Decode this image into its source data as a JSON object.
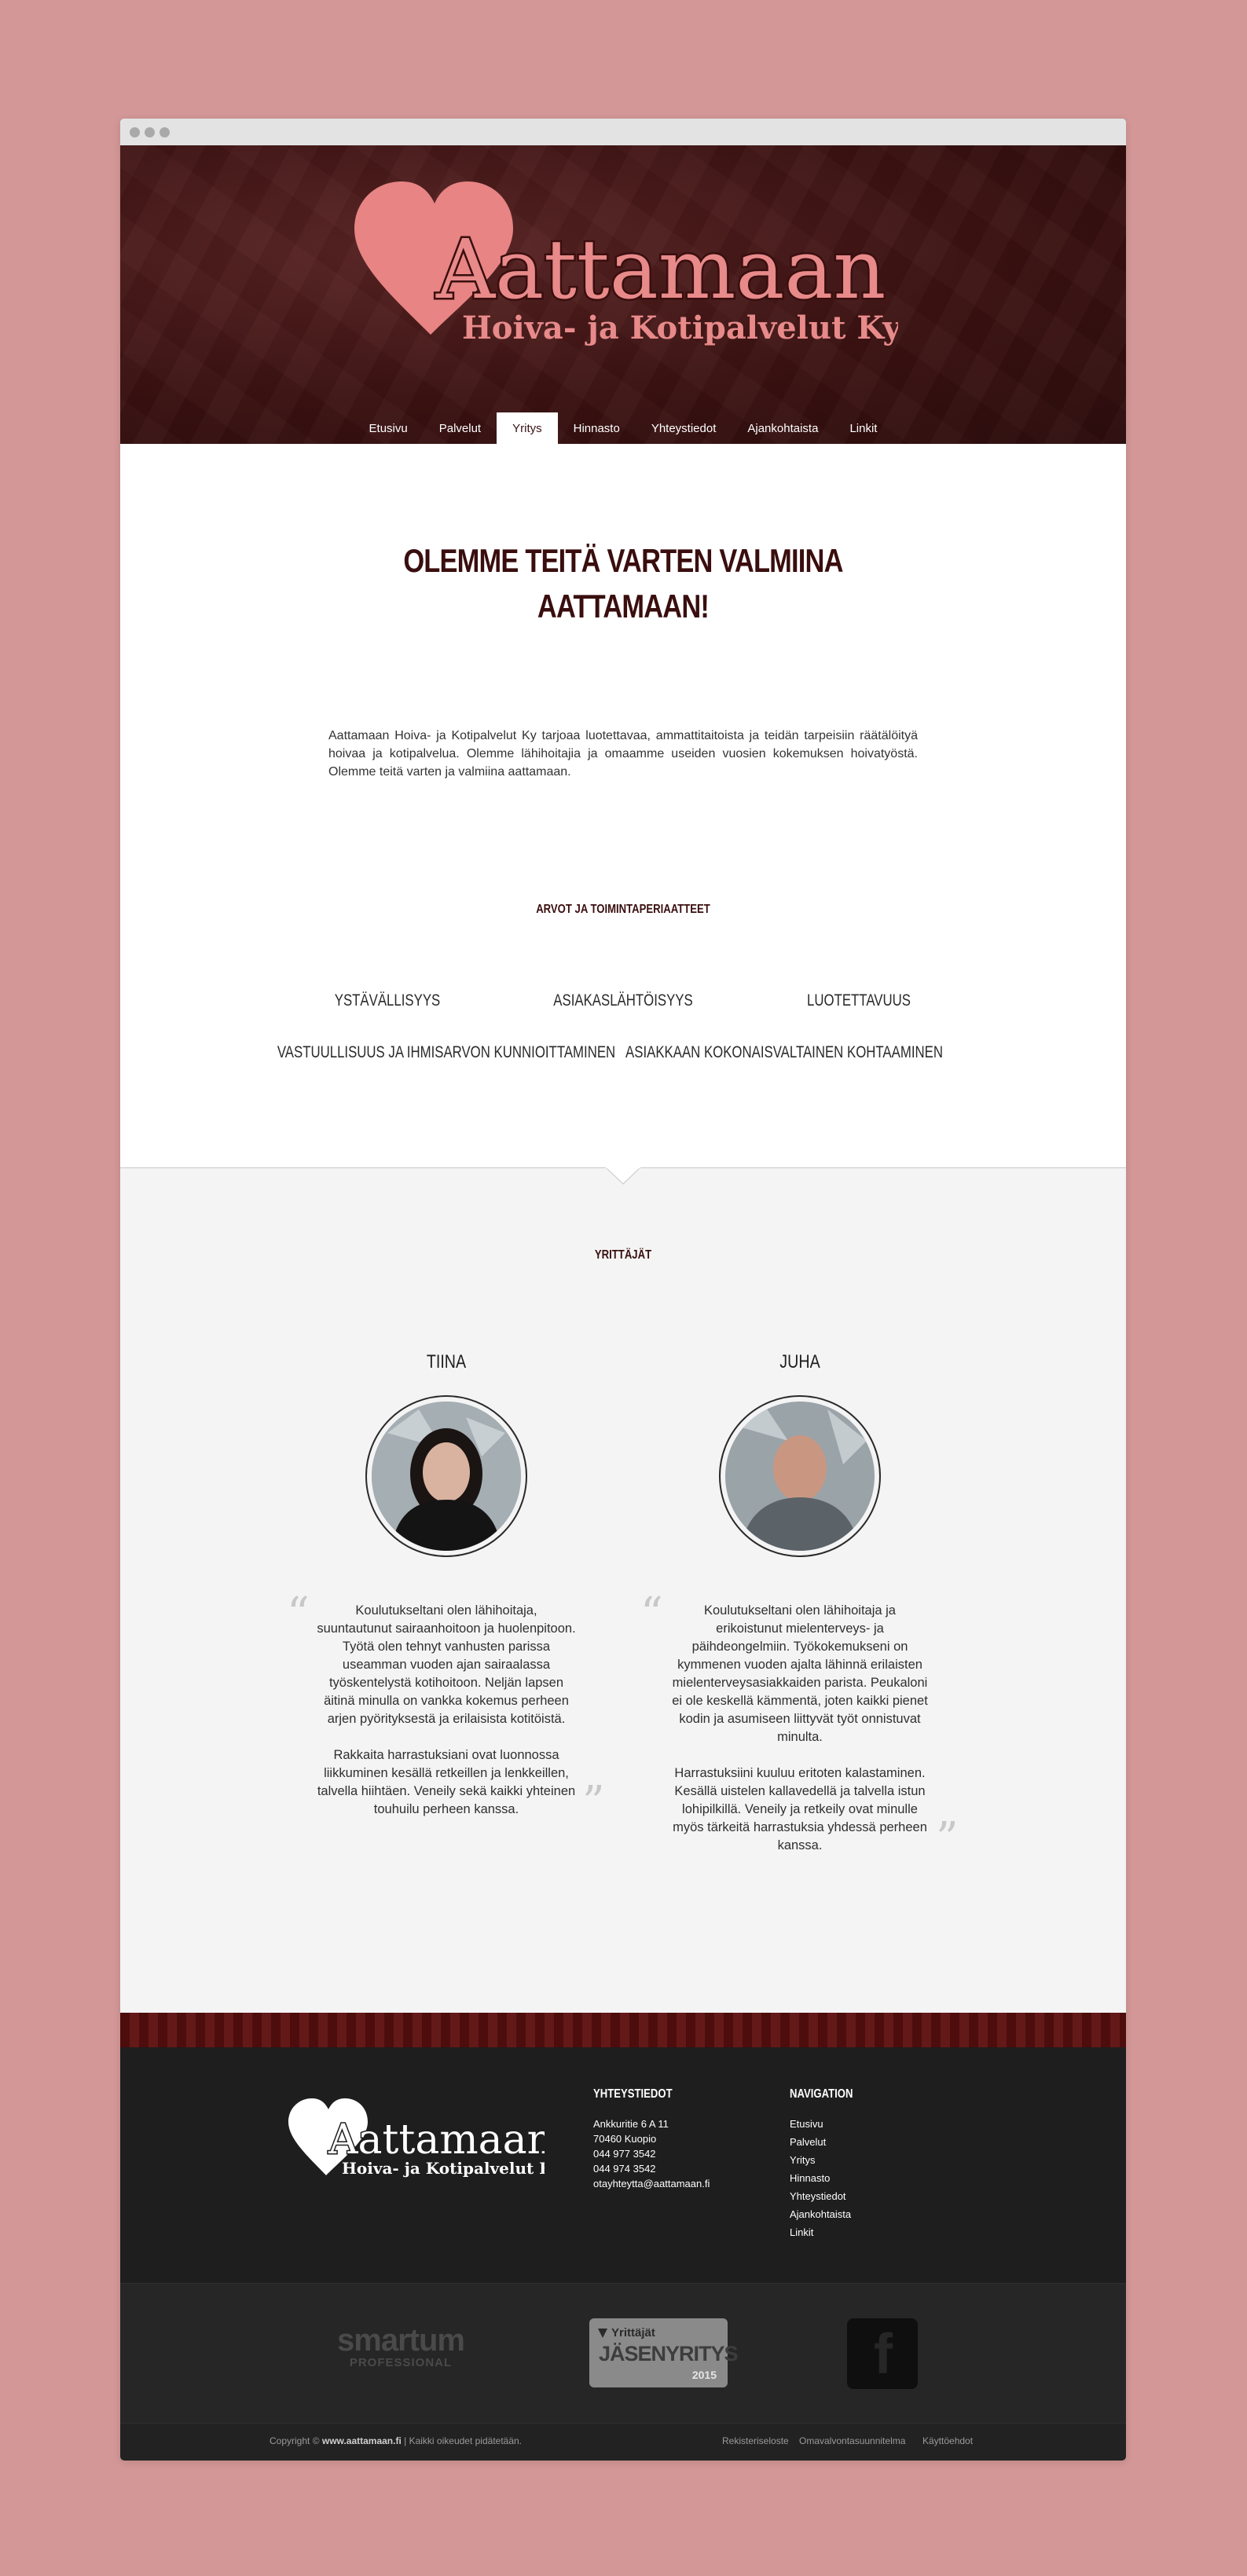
{
  "header": {
    "logo_name": "Aattamaan",
    "logo_tagline": "Hoiva- ja Kotipalvelut Ky"
  },
  "nav": {
    "items": [
      "Etusivu",
      "Palvelut",
      "Yritys",
      "Hinnasto",
      "Yhteystiedot",
      "Ajankohtaista",
      "Linkit"
    ],
    "active": "Yritys"
  },
  "intro": {
    "title_line1": "OLEMME TEITÄ VARTEN VALMIINA",
    "title_line2": "AATTAMAAN!",
    "text": "Aattamaan Hoiva- ja Kotipalvelut Ky tarjoaa luotettavaa, ammattitaitoista ja teidän tarpeisiin räätälöityä hoivaa ja kotipalvelua. Olemme lähihoitajia ja omaamme useiden vuosien kokemuksen hoivatyöstä. Olemme teitä varten ja valmiina aattamaan."
  },
  "values": {
    "heading": "ARVOT JA TOIMINTAPERIAATTEET",
    "items": [
      "YSTÄVÄLLISYYS",
      "ASIAKASLÄHTÖISYYS",
      "LUOTETTAVUUS",
      "VASTUULLISUUS JA IHMISARVON KUNNIOITTAMINEN",
      "ASIAKKAAN KOKONAISVALTAINEN KOHTAAMINEN"
    ]
  },
  "team": {
    "heading": "YRITTÄJÄT",
    "people": [
      {
        "name": "TIINA",
        "p1": "Koulutukseltani olen lähihoitaja, suuntautunut sairaanhoitoon ja huolenpitoon. Työtä olen tehnyt vanhusten parissa useamman vuoden ajan sairaalassa työskentelystä kotihoitoon. Neljän lapsen äitinä minulla on vankka kokemus perheen arjen pyörityksestä ja erilaisista kotitöistä.",
        "p2": "Rakkaita harrastuksiani ovat luonnossa liikkuminen kesällä retkeillen ja lenkkeillen, talvella hiihtäen. Veneily sekä kaikki yhteinen touhuilu perheen kanssa."
      },
      {
        "name": "JUHA",
        "p1": "Koulutukseltani olen lähihoitaja ja erikoistunut mielenterveys- ja päihdeongelmiin. Työkokemukseni on kymmenen vuoden ajalta lähinnä erilaisten mielenterveysasiakkaiden parista. Peukaloni ei ole keskellä kämmentä, joten kaikki pienet kodin ja asumiseen liittyvät työt onnistuvat minulta.",
        "p2": "Harrastuksiini kuuluu eritoten kalastaminen. Kesällä uistelen kallavedellä ja talvella istun lohipilkillä. Veneily ja retkeily ovat minulle myös tärkeitä harrastuksia yhdessä perheen kanssa."
      }
    ],
    "quote_open": "“",
    "quote_close": "”"
  },
  "footer": {
    "contact": {
      "title": "YHTEYSTIEDOT",
      "lines": [
        "Ankkuritie 6 A 11",
        "70460 Kuopio",
        "044 977 3542",
        "044 974 3542",
        "otayhteytta@aattamaan.fi"
      ]
    },
    "navigation": {
      "title": "NAVIGATION",
      "links": [
        "Etusivu",
        "Palvelut",
        "Yritys",
        "Hinnasto",
        "Yhteystiedot",
        "Ajankohtaista",
        "Linkit"
      ]
    },
    "partners": {
      "smartum": "smartum",
      "smartum_sub": "PROFESSIONAL",
      "badge_top": "Yrittäjät",
      "badge_main": "JÄSENYRITYS",
      "badge_year": "2015",
      "facebook": "f"
    },
    "copyright_prefix": "Copyright © ",
    "copyright_site": "www.aattamaan.fi",
    "copyright_suffix": " | Kaikki oikeudet pidätetään.",
    "legal": [
      "Rekisteriseloste",
      "Omavalvontasuunnitelma",
      "Käyttöehdot"
    ]
  },
  "colors": {
    "page_bg": "#d39797",
    "header_bg": "#3c1212",
    "logo_pink": "#e88888",
    "heading_dark": "#3a0e0e",
    "footer_bg": "#1e1e1e"
  }
}
